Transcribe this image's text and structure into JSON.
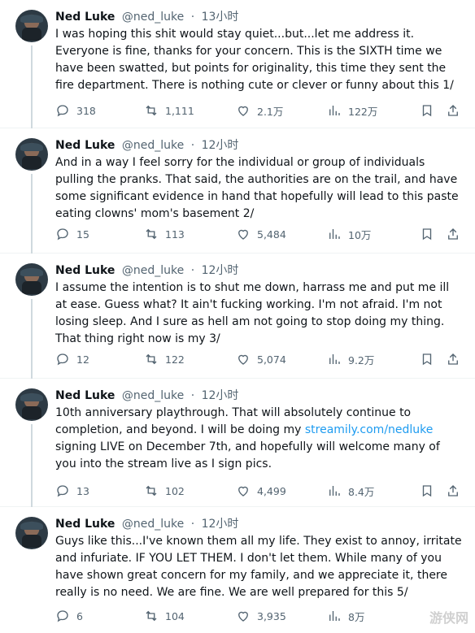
{
  "tweets": [
    {
      "name": "Ned Luke",
      "handle": "@ned_luke",
      "time": "13小时",
      "text": "I was hoping this shit would stay quiet...but...let me address it. Everyone is fine, thanks for your concern. This is the SIXTH time we have been swatted, but points for originality, this time they sent the fire department. There is nothing cute or clever or funny about this 1/",
      "replies": "318",
      "retweets": "1,111",
      "likes": "2.1万",
      "views": "122万"
    },
    {
      "name": "Ned Luke",
      "handle": "@ned_luke",
      "time": "12小时",
      "text": "And in a way I feel sorry for the individual or group of individuals pulling the pranks.  That said, the authorities are on the trail, and have some significant evidence in hand that hopefully will lead to this paste eating clowns' mom's basement 2/",
      "replies": "15",
      "retweets": "113",
      "likes": "5,484",
      "views": "10万"
    },
    {
      "name": "Ned Luke",
      "handle": "@ned_luke",
      "time": "12小时",
      "text": "I assume the intention is to shut me down, harrass me and put me ill at ease.  Guess what?  It ain't fucking working. I'm not afraid. I'm not losing sleep. And I sure as hell am not going to stop doing my thing. That thing right now is my 3/",
      "replies": "12",
      "retweets": "122",
      "likes": "5,074",
      "views": "9.2万"
    },
    {
      "name": "Ned Luke",
      "handle": "@ned_luke",
      "time": "12小时",
      "text_before": "10th anniversary playthrough. That will absolutely continue to completion, and beyond. I will be doing my ",
      "link": "streamily.com/nedluke",
      "text_after": " signing LIVE on December 7th, and hopefully will welcome many of you into the stream live as I sign pics.",
      "replies": "13",
      "retweets": "102",
      "likes": "4,499",
      "views": "8.4万"
    },
    {
      "name": "Ned Luke",
      "handle": "@ned_luke",
      "time": "12小时",
      "text": "Guys like this...I've known them all my life. They exist to annoy, irritate and infuriate. IF YOU LET THEM. I don't let them. While many of you have shown great concern for my family, and we appreciate it, there really is no need.  We are fine. We are well prepared for this 5/",
      "replies": "6",
      "retweets": "104",
      "likes": "3,935",
      "views": "8万"
    }
  ],
  "watermark": "游侠网"
}
